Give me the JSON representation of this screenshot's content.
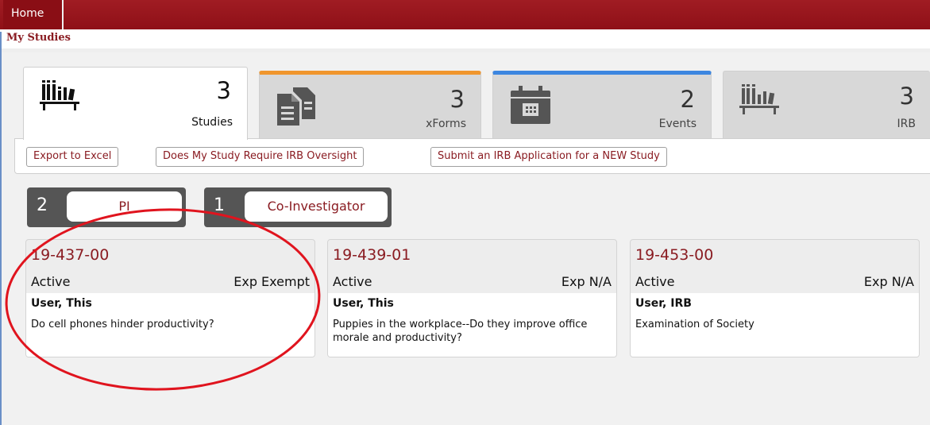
{
  "nav": {
    "home_label": "Home"
  },
  "page": {
    "title": "My Studies"
  },
  "summary_tabs": [
    {
      "count": "3",
      "label": "Studies",
      "icon": "bookshelf-icon",
      "active": true
    },
    {
      "count": "3",
      "label": "xForms",
      "icon": "document-icon",
      "accent": "#f0962d"
    },
    {
      "count": "2",
      "label": "Events",
      "icon": "calendar-icon",
      "accent": "#3d86e0"
    },
    {
      "count": "3",
      "label": "IRB",
      "icon": "bookshelf-icon"
    }
  ],
  "actions": {
    "export": "Export to Excel",
    "oversight": "Does My Study Require IRB Oversight",
    "submit": "Submit an IRB Application for a NEW Study"
  },
  "roles": [
    {
      "count": "2",
      "label": "PI"
    },
    {
      "count": "1",
      "label": "Co-Investigator"
    }
  ],
  "studies": [
    {
      "id": "19-437-00",
      "status": "Active",
      "exp": "Exp Exempt",
      "pi": "User, This",
      "title": "Do cell phones hinder productivity?"
    },
    {
      "id": "19-439-01",
      "status": "Active",
      "exp": "Exp N/A",
      "pi": "User, This",
      "title": "Puppies in the workplace--Do they improve office morale and productivity?"
    },
    {
      "id": "19-453-00",
      "status": "Active",
      "exp": "Exp N/A",
      "pi": "User, IRB",
      "title": "Examination of Society"
    }
  ],
  "colors": {
    "brand": "#8f1017",
    "link": "#8a1c22",
    "annotation": "#e0141e"
  }
}
